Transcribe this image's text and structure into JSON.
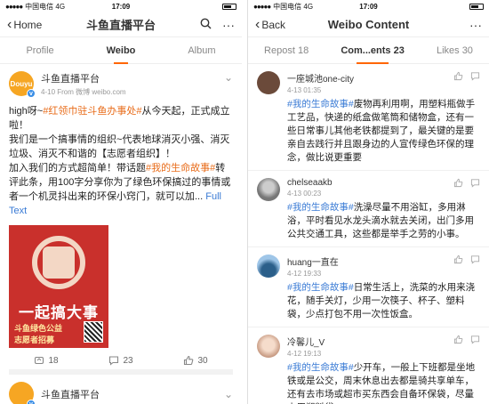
{
  "left": {
    "status": {
      "carrier": "中国电信",
      "network": "4G",
      "time": "17:09",
      "battery_pct": 50
    },
    "nav": {
      "back_label": "Home",
      "title": "斗鱼直播平台"
    },
    "tabs": [
      {
        "label": "Profile"
      },
      {
        "label": "Weibo"
      },
      {
        "label": "Album"
      }
    ],
    "post": {
      "avatar_text": "Douyu",
      "author": "斗鱼直播平台",
      "meta": "4-10  From 微博 weibo.com",
      "text": {
        "l1_pre": "high呀~",
        "l1_link": "#红领巾驻斗鱼办事处#",
        "l1_post": "从今天起，正式成立啦！",
        "l2": "我们是一个搞事情的组织~代表地球消灭小强、消灭垃圾、消灭不和谐的【志愿者组织】！",
        "l3_pre": "加入我们的方式超简单！带话题",
        "l3_link": "#我的生命故事#",
        "l3_post": "转评此条，用100字分享你为了绿色环保搞过的事情或者一个机灵抖出来的环保小窍门，就可以加...",
        "full_text": "Full Text"
      },
      "poster": {
        "headline": "一起搞大事",
        "sub1": "斗鱼绿色公益",
        "sub2": "志愿者招募"
      },
      "actions": {
        "repost": "18",
        "comment": "23",
        "like": "30"
      }
    },
    "post2": {
      "author": "斗鱼直播平台"
    }
  },
  "right": {
    "status": {
      "carrier": "中国电信",
      "network": "4G",
      "time": "17:09",
      "battery_pct": 50
    },
    "nav": {
      "back_label": "Back",
      "title": "Weibo Content"
    },
    "tabs": [
      {
        "label": "Repost 18"
      },
      {
        "label": "Com...ents 23"
      },
      {
        "label": "Likes 30"
      }
    ],
    "comments": [
      {
        "name": "一座城池one-city",
        "date": "4-13 01:35",
        "link": "#我的生命故事#",
        "text": "废物再利用啊，用塑料瓶做手工艺品，快递的纸盒做笔筒和储物盒，还有一些日常事儿其他老铁都提到了，最关键的是要亲自去践行并且跟身边的人宣传绿色环保的理念，做比说更重要",
        "avatar_color": "#6b4a3a"
      },
      {
        "name": "chelseaakb",
        "date": "4-13 00:23",
        "link": "#我的生命故事#",
        "text": "洗澡尽量不用浴缸，多用淋浴，平时看见水龙头滴水就去关闭，出门多用公共交通工具，这些都是举手之劳的小事。",
        "avatar_color": "#9a9a9a"
      },
      {
        "name": "huang一直在",
        "date": "4-12 19:33",
        "link": "#我的生命故事#",
        "text": "日常生活上，洗菜的水用来浇花，随手关灯，少用一次筷子、杯子、塑料袋，少点打包不用一次性饭盒。",
        "avatar_color": "#4a90c8"
      },
      {
        "name": "冷馨儿_V",
        "date": "4-12 19:13",
        "link": "#我的生命故事#",
        "text": "少开车，一般上下班都是坐地铁或是公交，周末休息出去都是骑共享单车，还有去市场或超市买东西会自备环保袋，尽量少用塑料袋。",
        "avatar_color": "#e8c4b0"
      }
    ]
  },
  "colors": {
    "accent_orange": "#f60",
    "link_orange": "#e86c1a",
    "link_blue": "#3a7bd5",
    "poster_red": "#c9302c"
  }
}
